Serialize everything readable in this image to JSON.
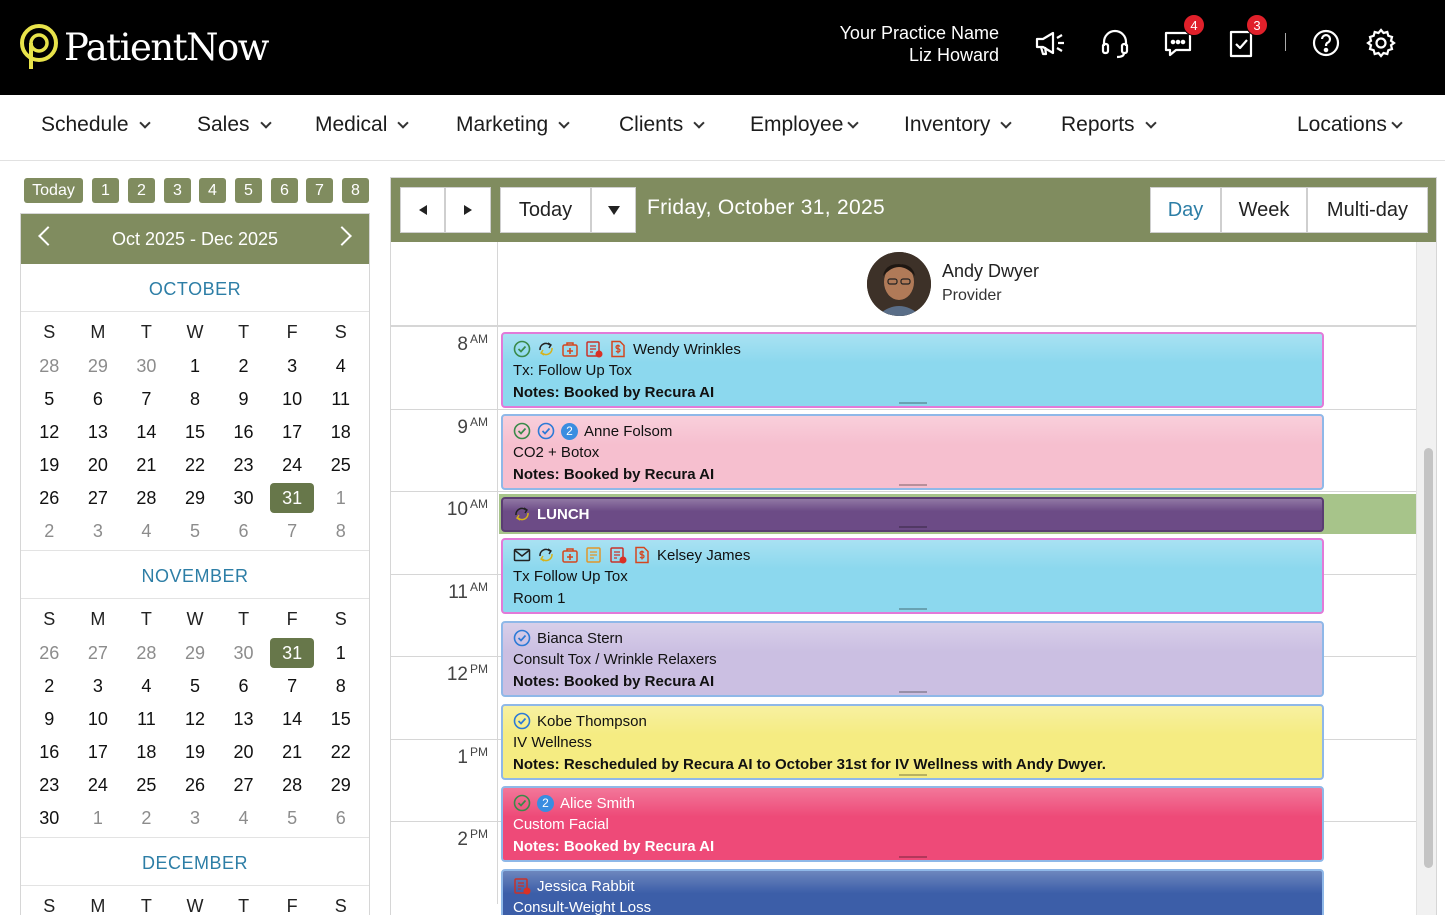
{
  "header": {
    "logo_text": "PatientNow",
    "practice_name": "Your Practice Name",
    "user_name": "Liz Howard",
    "icons": [
      "megaphone-icon",
      "headset-icon",
      "chat-icon",
      "tasks-icon",
      "help-icon",
      "settings-icon"
    ],
    "messages_count": "4",
    "tasks_count": "3"
  },
  "nav": {
    "items": [
      "Schedule",
      "Sales",
      "Medical",
      "Marketing",
      "Clients",
      "Employee",
      "Inventory",
      "Reports"
    ],
    "locations": "Locations"
  },
  "quick_buttons": [
    "Today",
    "1",
    "2",
    "3",
    "4",
    "5",
    "6",
    "7",
    "8"
  ],
  "mini_calendar": {
    "range": "Oct 2025 - Dec 2025",
    "weekdays": [
      "S",
      "M",
      "T",
      "W",
      "T",
      "F",
      "S"
    ],
    "months": [
      {
        "name": "OCTOBER",
        "weeks": [
          [
            "28",
            "29",
            "30",
            "1",
            "2",
            "3",
            "4"
          ],
          [
            "5",
            "6",
            "7",
            "8",
            "9",
            "10",
            "11"
          ],
          [
            "12",
            "13",
            "14",
            "15",
            "16",
            "17",
            "18"
          ],
          [
            "19",
            "20",
            "21",
            "22",
            "23",
            "24",
            "25"
          ],
          [
            "26",
            "27",
            "28",
            "29",
            "30",
            "31",
            "1"
          ],
          [
            "2",
            "3",
            "4",
            "5",
            "6",
            "7",
            "8"
          ]
        ]
      },
      {
        "name": "NOVEMBER",
        "weeks": [
          [
            "26",
            "27",
            "28",
            "29",
            "30",
            "31",
            "1"
          ],
          [
            "2",
            "3",
            "4",
            "5",
            "6",
            "7",
            "8"
          ],
          [
            "9",
            "10",
            "11",
            "12",
            "13",
            "14",
            "15"
          ],
          [
            "16",
            "17",
            "18",
            "19",
            "20",
            "21",
            "22"
          ],
          [
            "23",
            "24",
            "25",
            "26",
            "27",
            "28",
            "29"
          ],
          [
            "30",
            "1",
            "2",
            "3",
            "4",
            "5",
            "6"
          ]
        ]
      },
      {
        "name": "DECEMBER",
        "weeks": []
      }
    ]
  },
  "toolbar": {
    "today_label": "Today",
    "date_title": "Friday, October 31, 2025",
    "views": [
      "Day",
      "Week",
      "Multi-day"
    ],
    "active_view": "Day"
  },
  "provider": {
    "name": "Andy Dwyer",
    "role": "Provider"
  },
  "time_slots": [
    {
      "hour": "8",
      "period": "AM"
    },
    {
      "hour": "9",
      "period": "AM"
    },
    {
      "hour": "10",
      "period": "AM"
    },
    {
      "hour": "11",
      "period": "AM"
    },
    {
      "hour": "12",
      "period": "PM"
    },
    {
      "hour": "1",
      "period": "PM"
    },
    {
      "hour": "2",
      "period": "PM"
    }
  ],
  "appointments": [
    {
      "patient": "Wendy Wrinkles",
      "service": "Tx: Follow Up Tox",
      "notes": "Notes: Booked by Recura AI",
      "color": "#8cd8ee",
      "border": "#e27ad8",
      "icons": [
        "check-circle-icon",
        "recurring-icon",
        "medical-bag-icon",
        "form-alert-icon",
        "invoice-icon"
      ]
    },
    {
      "patient": "Anne Folsom",
      "service": "CO2 + Botox",
      "notes": "Notes: Booked by Recura AI",
      "color": "#f6bfcf",
      "border": "#8fb8e8",
      "icons": [
        "check-circle-icon",
        "confirmed-icon"
      ],
      "badge": "2"
    },
    {
      "patient": "LUNCH",
      "color": "#6c4b86",
      "border": "#5a3d72",
      "icons": [
        "recurring-icon"
      ]
    },
    {
      "patient": "Kelsey James",
      "service": "Tx Follow Up Tox",
      "notes": "Room 1",
      "color": "#8cd8ee",
      "border": "#e27ad8",
      "icons": [
        "email-icon",
        "recurring-icon",
        "medical-bag-icon",
        "form-icon",
        "form-alert-icon",
        "invoice-icon"
      ]
    },
    {
      "patient": "Bianca Stern",
      "service": "Consult Tox / Wrinkle Relaxers",
      "notes": "Notes: Booked by Recura AI",
      "color": "#cbbfe2",
      "border": "#8fb8e8",
      "icons": [
        "confirmed-icon"
      ]
    },
    {
      "patient": "Kobe Thompson",
      "service": "IV Wellness",
      "notes": "Notes: Rescheduled by Recura AI to October 31st for IV Wellness with Andy Dwyer.",
      "color": "#f5ec82",
      "border": "#8fb8e8",
      "icons": [
        "confirmed-icon"
      ]
    },
    {
      "patient": "Alice Smith",
      "service": "Custom Facial",
      "notes": "Notes: Booked by Recura AI",
      "color": "#ee4a78",
      "border": "#8fb8e8",
      "icons": [
        "check-circle-icon"
      ],
      "badge": "2"
    },
    {
      "patient": "Jessica Rabbit",
      "service": "Consult-Weight Loss",
      "color": "#3c5ea8",
      "border": "#8fb8e8",
      "icons": [
        "form-alert-icon"
      ]
    }
  ],
  "colors": {
    "brand_black": "#000000",
    "accent_olive": "#808c5f",
    "selected_day": "#67774a",
    "link_blue": "#2d7ea6",
    "lunch_band": "#a7c48a",
    "badge_red": "#e0202a"
  }
}
